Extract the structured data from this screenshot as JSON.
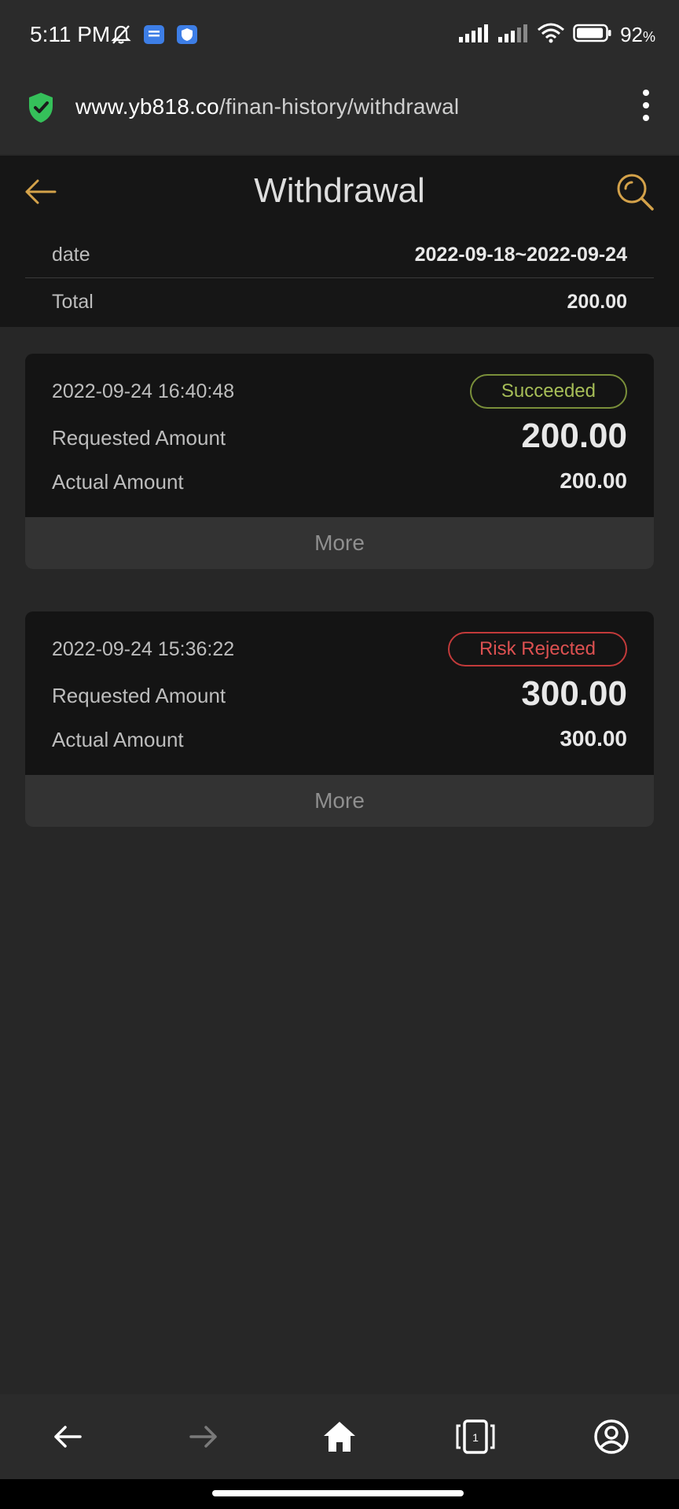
{
  "status_bar": {
    "time": "5:11 PM",
    "battery_percent": "92",
    "battery_unit": "%",
    "battery_level": 0.92,
    "icons_left": [
      "bell-off-icon",
      "message-app-icon",
      "shield-app-icon"
    ],
    "icons_right": [
      "signal-icon",
      "signal-icon",
      "wifi-icon",
      "battery-icon"
    ]
  },
  "browser": {
    "url_host": "www.yb818.co",
    "url_path": "/finan-history/withdrawal",
    "secure_icon": "shield-check-icon",
    "menu_icon": "more-vertical-icon"
  },
  "header": {
    "title": "Withdrawal",
    "date_label": "date",
    "date_value": "2022-09-18~2022-09-24",
    "total_label": "Total",
    "total_value": "200.00"
  },
  "records": [
    {
      "time": "2022-09-24 16:40:48",
      "status": "Succeeded",
      "status_color": "#a6bd57",
      "requested_label": "Requested Amount",
      "requested_value": "200.00",
      "actual_label": "Actual Amount",
      "actual_value": "200.00",
      "more_label": "More"
    },
    {
      "time": "2022-09-24 15:36:22",
      "status": "Risk Rejected",
      "status_color": "#dd5151",
      "requested_label": "Requested Amount",
      "requested_value": "300.00",
      "actual_label": "Actual Amount",
      "actual_value": "300.00",
      "more_label": "More"
    }
  ],
  "bottom_nav": {
    "items": [
      "back-icon",
      "forward-icon",
      "home-icon",
      "tabs-icon",
      "account-icon"
    ],
    "tab_count": "1"
  },
  "colors": {
    "accent": "#d4a24a",
    "background": "#272727",
    "header_bg": "#161616"
  }
}
